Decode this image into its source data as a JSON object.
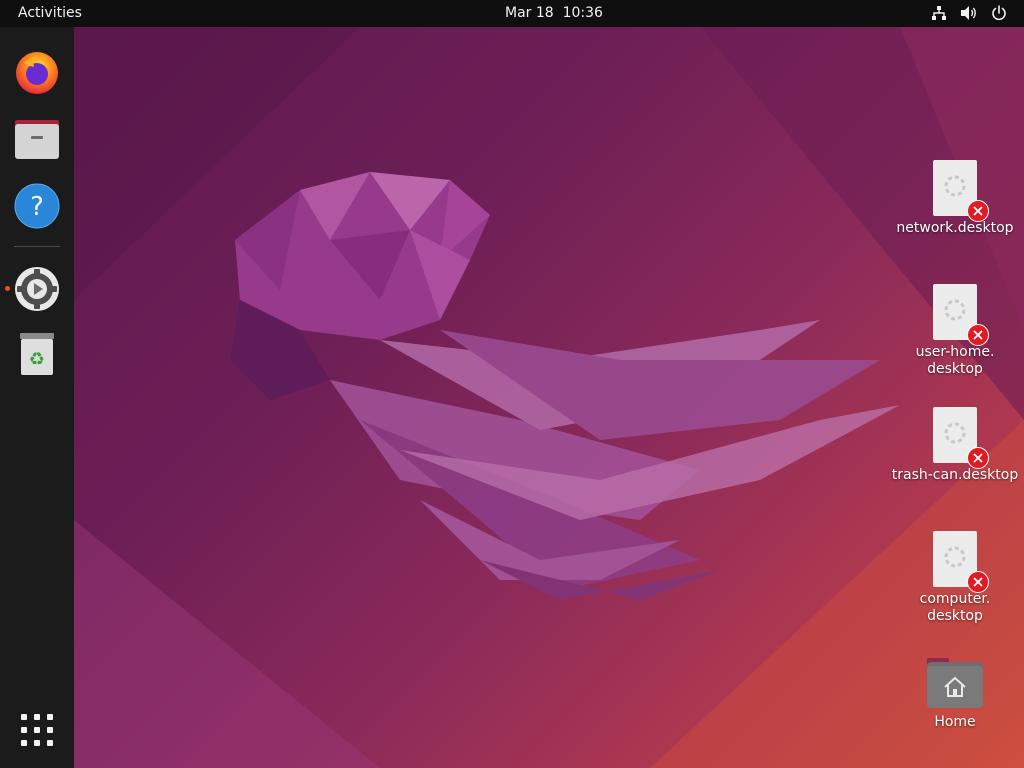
{
  "topbar": {
    "activities_label": "Activities",
    "date": "Mar 18",
    "time": "10:36",
    "tray_icons": [
      "network-icon",
      "volume-icon",
      "power-icon"
    ]
  },
  "dock": {
    "items": [
      {
        "name": "firefox",
        "icon": "firefox-icon"
      },
      {
        "name": "files",
        "icon": "files-icon"
      },
      {
        "name": "help",
        "icon": "help-icon"
      },
      {
        "name": "settings",
        "icon": "settings-icon",
        "running": true
      },
      {
        "name": "trash",
        "icon": "trash-icon"
      }
    ],
    "apps_grid_icon": "show-apps-icon"
  },
  "desktop": {
    "icons": [
      {
        "label": "network.desktop",
        "type": "broken-launcher"
      },
      {
        "label_line1": "user-home.",
        "label_line2": "desktop",
        "type": "broken-launcher"
      },
      {
        "label": "trash-can.desktop",
        "type": "broken-launcher"
      },
      {
        "label_line1": "computer.",
        "label_line2": "desktop",
        "type": "broken-launcher"
      },
      {
        "label": "Home",
        "type": "folder"
      }
    ]
  },
  "colors": {
    "topbar_bg": "#0f0f10",
    "dock_bg": "#1c1b1c",
    "accent": "#e95420",
    "error_badge": "#e01b24"
  }
}
